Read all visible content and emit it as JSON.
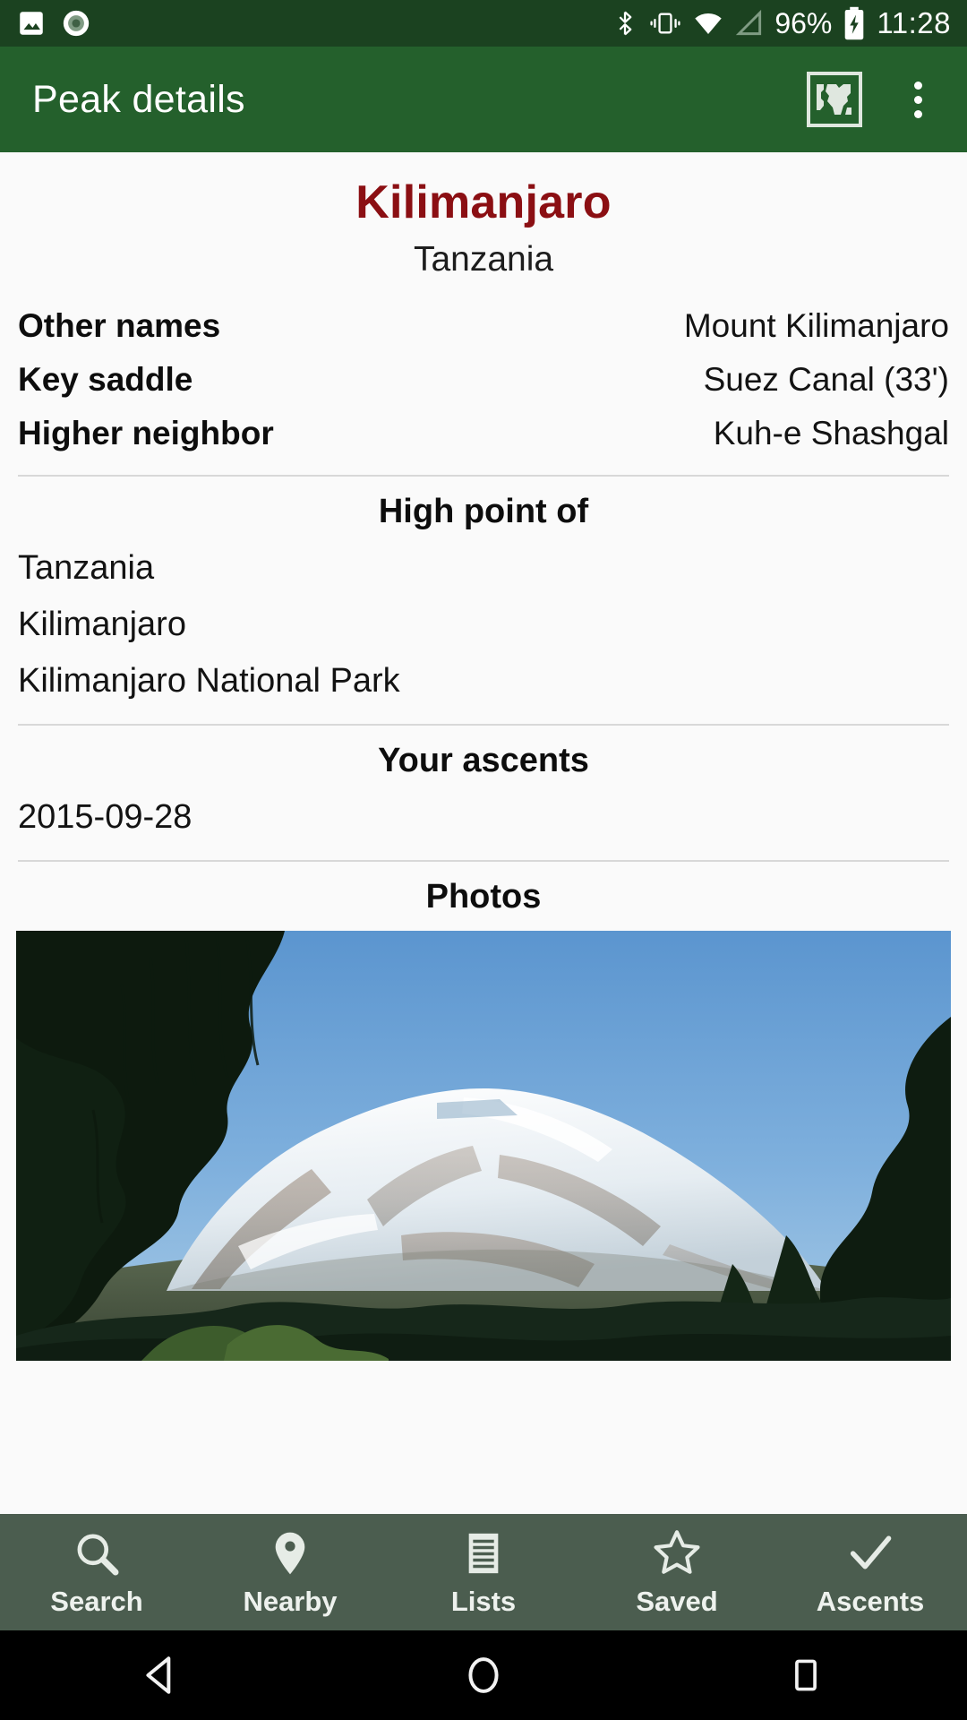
{
  "status_bar": {
    "icons_left": [
      "image-icon",
      "screen-record-icon"
    ],
    "icons_right": [
      "bluetooth-icon",
      "vibrate-icon",
      "wifi-icon",
      "signal-icon"
    ],
    "battery_percent": "96%",
    "battery_icon": "battery-charging-icon",
    "time": "11:28",
    "background_color": "#1b4220"
  },
  "app_bar": {
    "title": "Peak details",
    "map_icon": "world-map-icon",
    "overflow_icon": "more-vertical-icon",
    "background_color": "#24602c"
  },
  "peak": {
    "name": "Kilimanjaro",
    "name_color": "#8b0f13",
    "country": "Tanzania",
    "details": [
      {
        "key": "Other names",
        "value": "Mount Kilimanjaro"
      },
      {
        "key": "Key saddle",
        "value": "Suez Canal (33')"
      },
      {
        "key": "Higher neighbor",
        "value": "Kuh-e Shashgal"
      }
    ]
  },
  "high_point_of": {
    "title": "High point of",
    "items": [
      "Tanzania",
      "Kilimanjaro",
      "Kilimanjaro National Park"
    ]
  },
  "your_ascents": {
    "title": "Your ascents",
    "items": [
      "2015-09-28"
    ]
  },
  "photos": {
    "title": "Photos",
    "caption": "Snow-capped summit of Kilimanjaro framed by dark forest trees under a clear blue sky"
  },
  "bottom_nav": {
    "background_color": "#4b5d4f",
    "items": [
      {
        "label": "Search",
        "icon": "search-icon"
      },
      {
        "label": "Nearby",
        "icon": "location-pin-icon"
      },
      {
        "label": "Lists",
        "icon": "list-icon"
      },
      {
        "label": "Saved",
        "icon": "star-outline-icon"
      },
      {
        "label": "Ascents",
        "icon": "check-icon"
      }
    ]
  },
  "android_nav": {
    "back": "back-triangle-icon",
    "home": "home-circle-icon",
    "recents": "recents-square-icon"
  }
}
